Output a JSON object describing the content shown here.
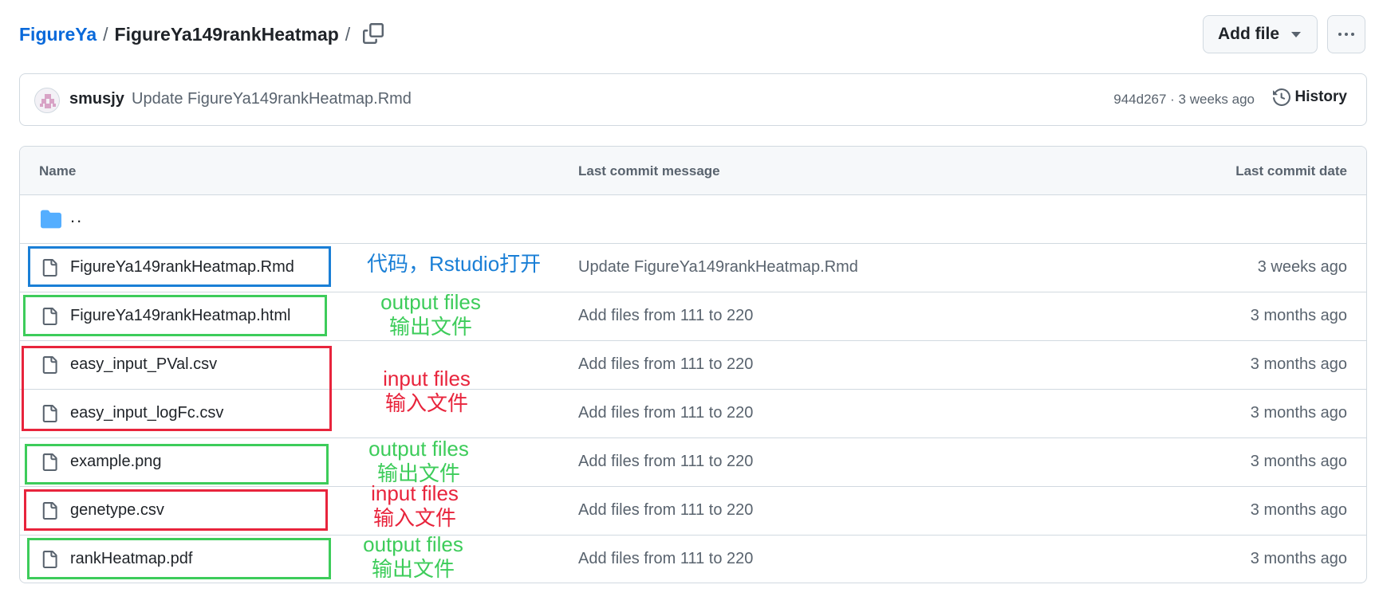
{
  "breadcrumb": {
    "repo": "FigureYa",
    "separator": "/",
    "folder": "FigureYa149rankHeatmap",
    "trailing": "/"
  },
  "toolbar": {
    "add_file_label": "Add file"
  },
  "commit": {
    "author": "smusjy",
    "message": "Update FigureYa149rankHeatmap.Rmd",
    "meta": "944d267 · 3 weeks ago",
    "history_label": "History"
  },
  "table": {
    "headers": {
      "name": "Name",
      "message": "Last commit message",
      "date": "Last commit date"
    },
    "parent_label": "..",
    "files": [
      {
        "name": "FigureYa149rankHeatmap.Rmd",
        "message": "Update FigureYa149rankHeatmap.Rmd",
        "date": "3 weeks ago"
      },
      {
        "name": "FigureYa149rankHeatmap.html",
        "message": "Add files from 111 to 220",
        "date": "3 months ago"
      },
      {
        "name": "easy_input_PVal.csv",
        "message": "Add files from 111 to 220",
        "date": "3 months ago"
      },
      {
        "name": "easy_input_logFc.csv",
        "message": "Add files from 111 to 220",
        "date": "3 months ago"
      },
      {
        "name": "example.png",
        "message": "Add files from 111 to 220",
        "date": "3 months ago"
      },
      {
        "name": "genetype.csv",
        "message": "Add files from 111 to 220",
        "date": "3 months ago"
      },
      {
        "name": "rankHeatmap.pdf",
        "message": "Add files from 111 to 220",
        "date": "3 months ago"
      }
    ]
  },
  "annotations": {
    "code": "代码，Rstudio打开",
    "output_line1": "output files",
    "output_line2": "输出文件",
    "input_line1": "input files",
    "input_line2": "输入文件"
  },
  "colors": {
    "link": "#0969da",
    "annotation_blue": "#1a7fd6",
    "annotation_green": "#3dcc5a",
    "annotation_red": "#e8243c",
    "folder_icon": "#54aeff"
  },
  "icons": {
    "copy": "copy-icon",
    "history": "history-icon",
    "folder": "folder-icon",
    "file": "file-icon",
    "caret": "caret-down-icon",
    "more": "kebab-horizontal-icon"
  }
}
